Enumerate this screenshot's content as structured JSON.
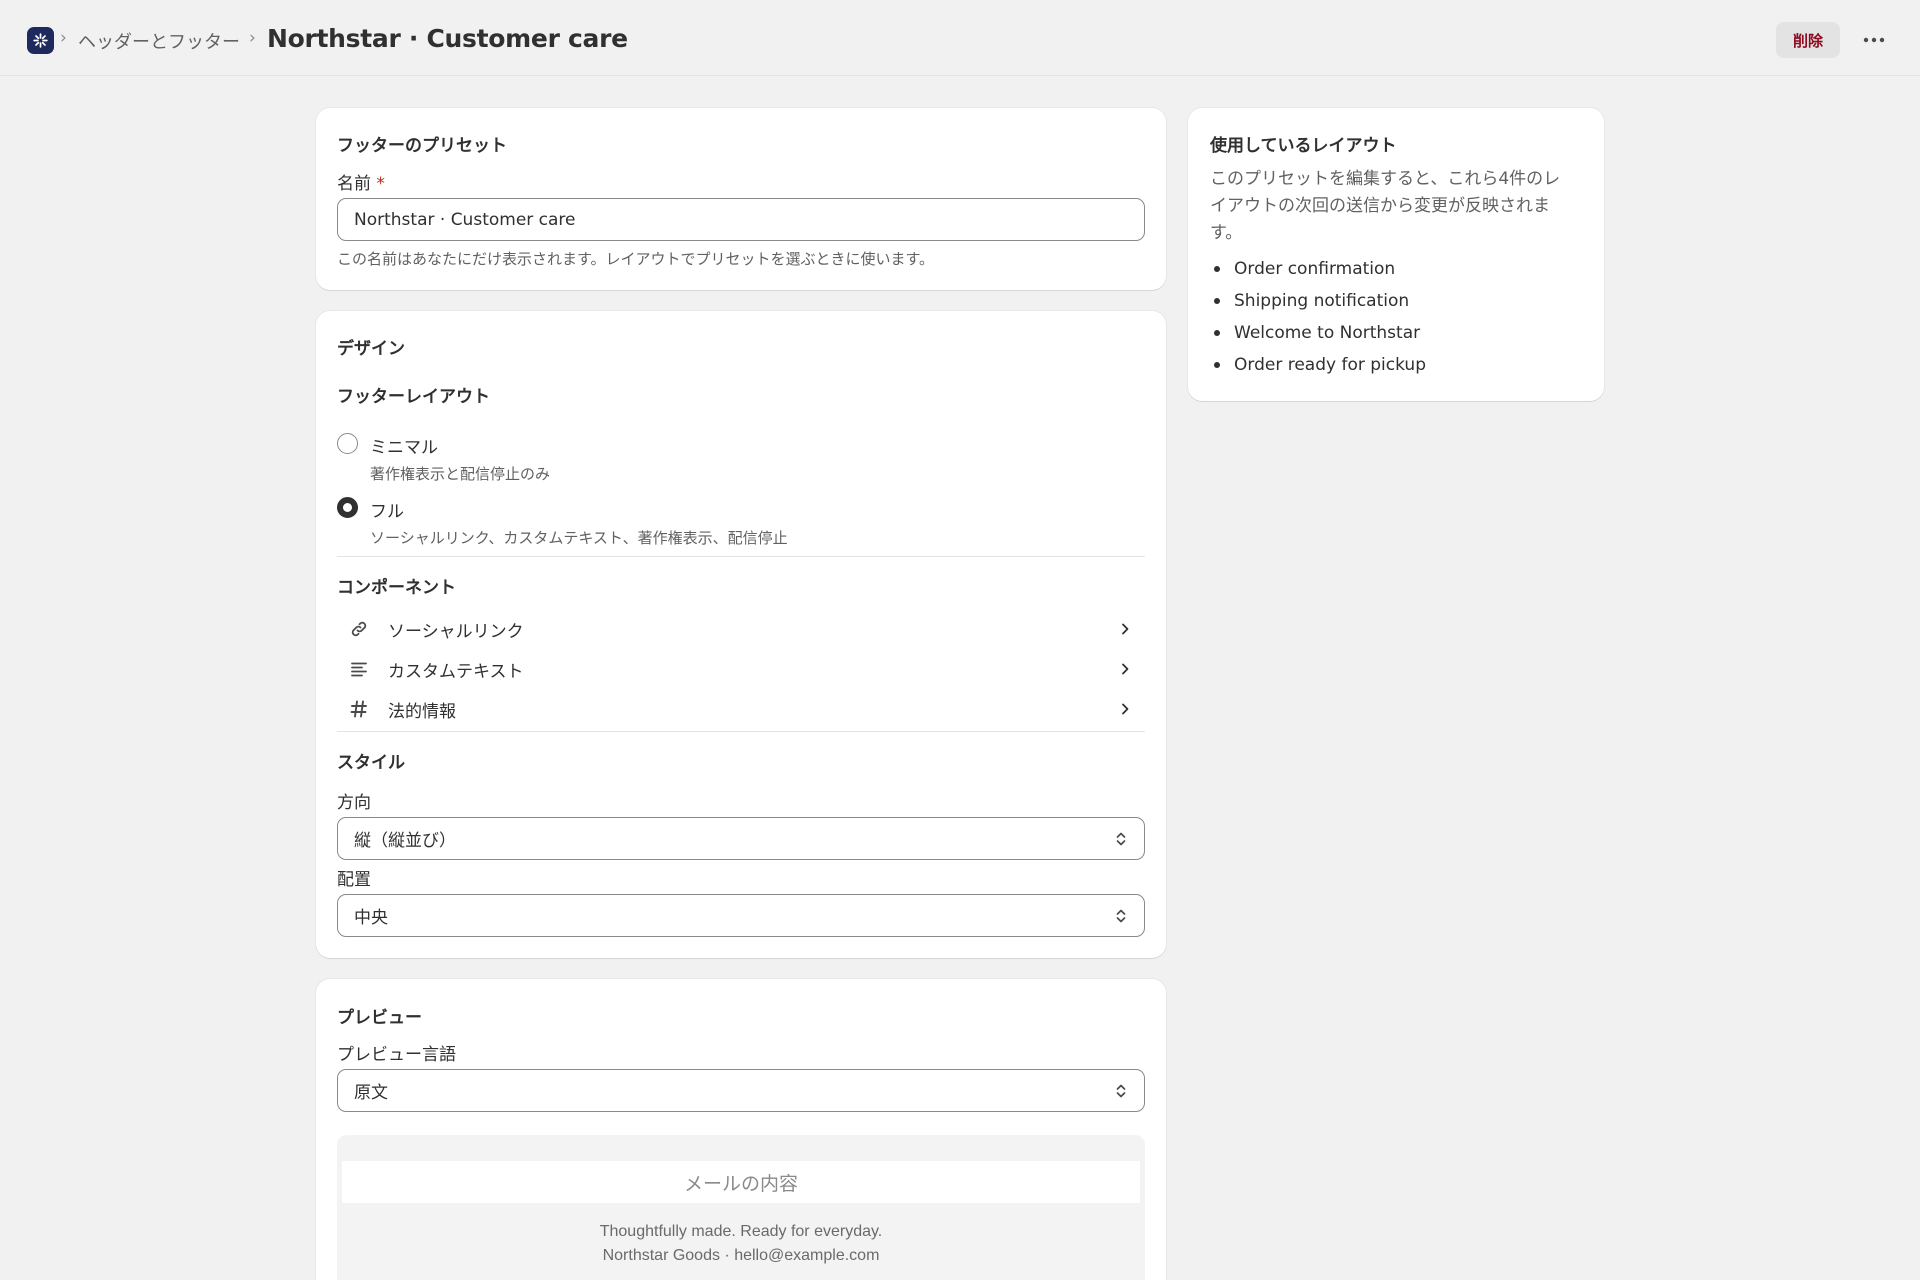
{
  "header": {
    "breadcrumb_parent": "ヘッダーとフッター",
    "title": "Northstar · Customer care",
    "delete_label": "削除",
    "more_icon": "ellipsis-icon"
  },
  "preset_card": {
    "title": "フッターのプリセット",
    "name_label": "名前",
    "required_mark": "*",
    "name_value": "Northstar · Customer care",
    "name_help": "この名前はあなたにだけ表示されます。レイアウトでプリセットを選ぶときに使います。"
  },
  "design_card": {
    "title": "デザイン",
    "layout_heading": "フッターレイアウト",
    "layout_options": [
      {
        "label": "ミニマル",
        "help": "著作権表示と配信停止のみ",
        "selected": false
      },
      {
        "label": "フル",
        "help": "ソーシャルリンク、カスタムテキスト、著作権表示、配信停止",
        "selected": true
      }
    ],
    "components_heading": "コンポーネント",
    "components": [
      {
        "label": "ソーシャルリンク",
        "icon": "link-icon"
      },
      {
        "label": "カスタムテキスト",
        "icon": "text-align-icon"
      },
      {
        "label": "法的情報",
        "icon": "hashtag-icon"
      }
    ],
    "style_heading": "スタイル",
    "direction_label": "方向",
    "direction_value": "縦（縦並び）",
    "alignment_label": "配置",
    "alignment_value": "中央"
  },
  "preview_card": {
    "title": "プレビュー",
    "language_label": "プレビュー言語",
    "language_value": "原文",
    "email_content_placeholder": "メールの内容",
    "footer_line1": "Thoughtfully made. Ready for everyday.",
    "footer_line2": "Northstar Goods · hello@example.com"
  },
  "layouts_card": {
    "title": "使用しているレイアウト",
    "description": "このプリセットを編集すると、これら4件のレイアウトの次回の送信から変更が反映されます。",
    "items": [
      "Order confirmation",
      "Shipping notification",
      "Welcome to Northstar",
      "Order ready for pickup"
    ]
  },
  "colors": {
    "background": "#f1f1f1",
    "card": "#ffffff",
    "text": "#303030",
    "muted": "#616161",
    "critical": "#8e0b21",
    "app_icon": "#1f2a5c"
  }
}
